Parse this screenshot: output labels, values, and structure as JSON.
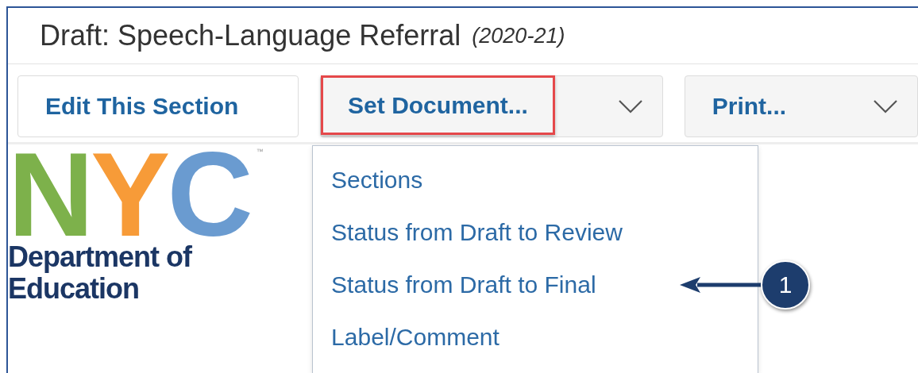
{
  "title": {
    "text": "Draft: Speech-Language Referral",
    "year": "(2020-21)"
  },
  "toolbar": [
    {
      "kind": "button",
      "label": "Edit This Section",
      "highlighted": false
    },
    {
      "kind": "split",
      "label": "Set Document...",
      "highlighted": true,
      "menu": {
        "items": [
          {
            "label": "Sections",
            "annotated": false
          },
          {
            "label": "Status from Draft to Review",
            "annotated": false
          },
          {
            "label": "Status from Draft to Final",
            "annotated": true
          },
          {
            "label": "Label/Comment",
            "annotated": false
          }
        ]
      }
    },
    {
      "kind": "split",
      "label": "Print...",
      "highlighted": false
    }
  ],
  "logo": {
    "letters": [
      {
        "text": "N",
        "color": "#7db14b"
      },
      {
        "text": "Y",
        "color": "#f79b38"
      },
      {
        "text": "C",
        "color": "#6a9bd0"
      }
    ],
    "trademark": "™",
    "caption": [
      "Department of",
      "Education"
    ]
  },
  "callout": {
    "number": "1"
  }
}
